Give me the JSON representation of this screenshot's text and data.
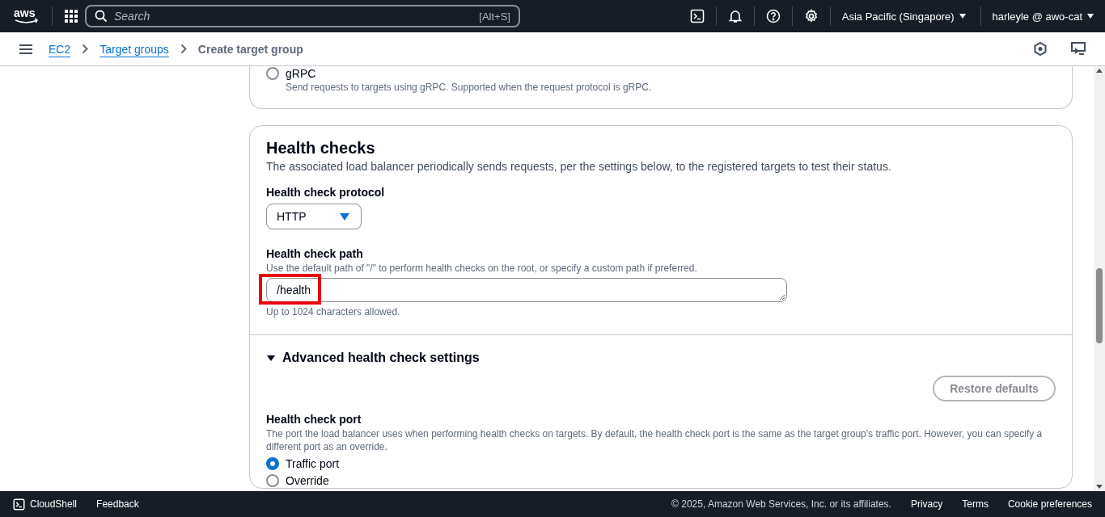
{
  "top_nav": {
    "logo_text": "aws",
    "search": {
      "placeholder": "Search",
      "shortcut": "[Alt+S]"
    },
    "region": "Asia Pacific (Singapore)",
    "account": "harleyle @ awo-cat"
  },
  "breadcrumbs": [
    {
      "label": "EC2",
      "link": true
    },
    {
      "label": "Target groups",
      "link": true
    },
    {
      "label": "Create target group",
      "link": false
    }
  ],
  "protocol_version": {
    "options": [
      {
        "label": "gRPC",
        "description": "Send requests to targets using gRPC. Supported when the request protocol is gRPC.",
        "selected": false
      }
    ]
  },
  "health_checks": {
    "title": "Health checks",
    "description": "The associated load balancer periodically sends requests, per the settings below, to the registered targets to test their status.",
    "protocol": {
      "label": "Health check protocol",
      "value": "HTTP"
    },
    "path": {
      "label": "Health check path",
      "description": "Use the default path of \"/\" to perform health checks on the root, or specify a custom path if preferred.",
      "value": "/health",
      "hint": "Up to 1024 characters allowed.",
      "highlighted": true
    },
    "advanced": {
      "title": "Advanced health check settings",
      "expanded": true,
      "restore_button": {
        "label": "Restore defaults",
        "disabled": true
      },
      "port": {
        "label": "Health check port",
        "description": "The port the load balancer uses when performing health checks on targets. By default, the health check port is the same as the target group's traffic port. However, you can specify a different port as an override.",
        "options": [
          {
            "label": "Traffic port",
            "selected": true
          },
          {
            "label": "Override",
            "selected": false
          }
        ]
      }
    }
  },
  "footer": {
    "left": [
      "CloudShell",
      "Feedback"
    ],
    "copyright": "© 2025, Amazon Web Services, Inc. or its affiliates.",
    "links": [
      "Privacy",
      "Terms",
      "Cookie preferences"
    ]
  }
}
